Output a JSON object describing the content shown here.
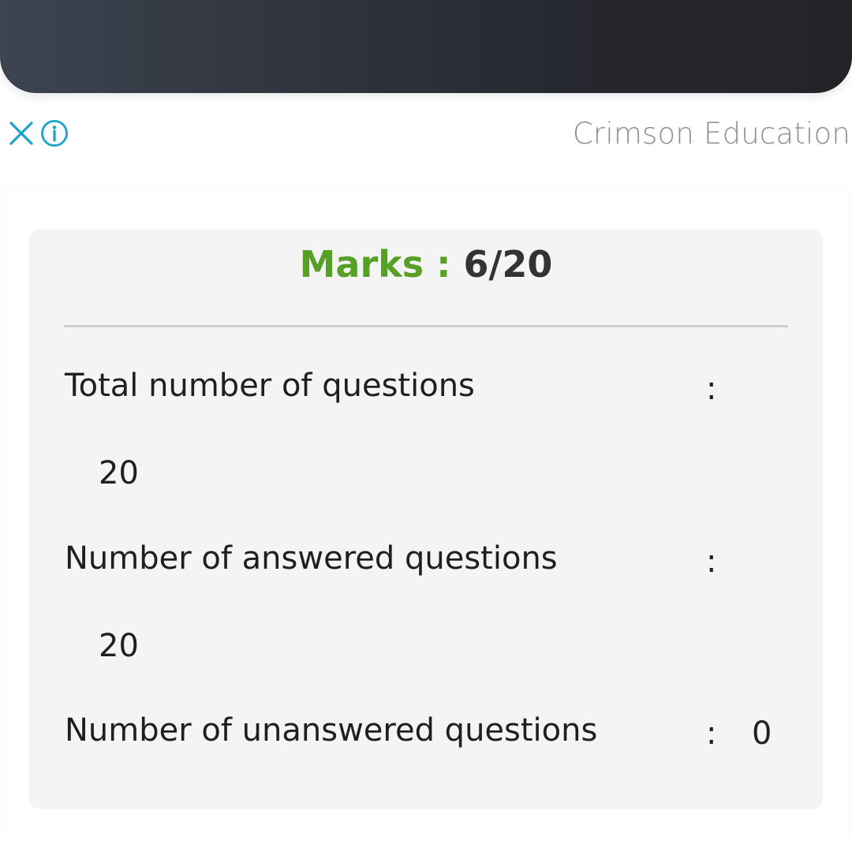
{
  "ad": {
    "advertiser": "Crimson Education",
    "close_icon": "close-icon",
    "info_icon": "info-icon",
    "accent_color": "#1aa3c8"
  },
  "result": {
    "marks_label": "Marks :",
    "marks_value": "6/20",
    "marks_label_color": "#56a025",
    "stats": [
      {
        "label": "Total number of questions",
        "separator": ":",
        "value": "20"
      },
      {
        "label": "Number of answered questions",
        "separator": ":",
        "value": "20"
      },
      {
        "label": "Number of unanswered questions",
        "separator": ":",
        "value": "0"
      }
    ]
  }
}
